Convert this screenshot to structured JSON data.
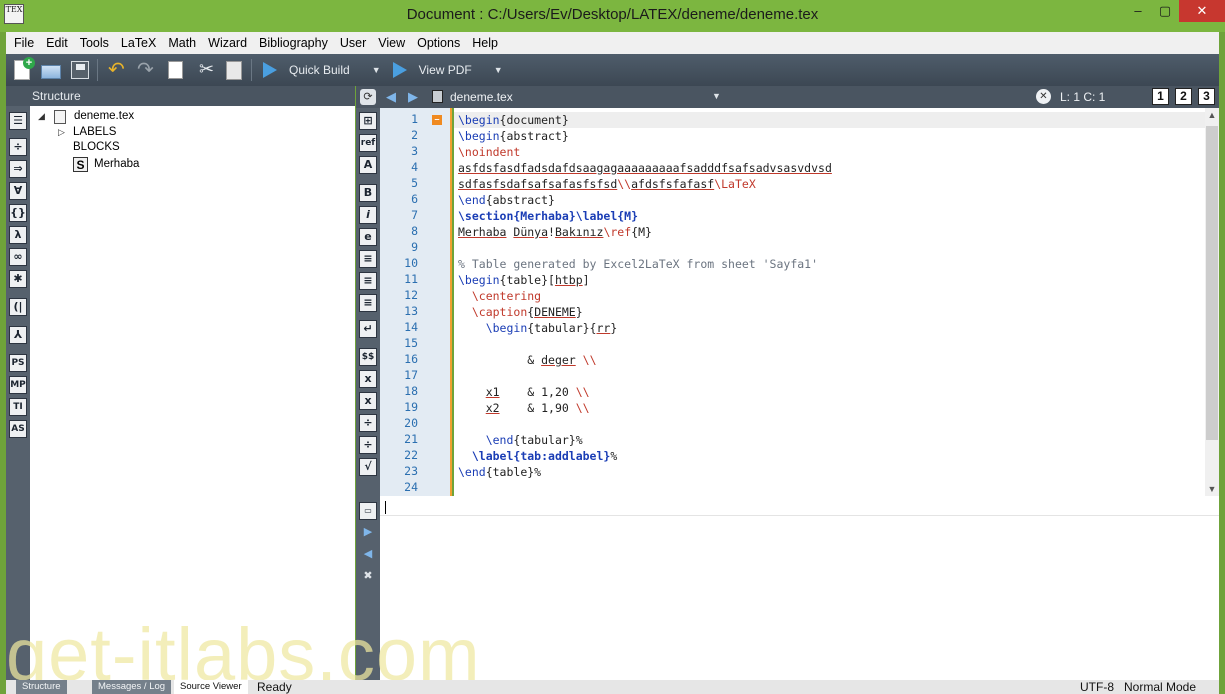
{
  "window": {
    "title": "Document : C:/Users/Ev/Desktop/LATEX/deneme/deneme.tex",
    "app_icon_text": "TEX",
    "close_glyph": "✕",
    "min_glyph": "–",
    "max_glyph": "▢"
  },
  "menu": [
    "File",
    "Edit",
    "Tools",
    "LaTeX",
    "Math",
    "Wizard",
    "Bibliography",
    "User",
    "View",
    "Options",
    "Help"
  ],
  "toolbar": {
    "quick_build_label": "Quick Build",
    "view_pdf_label": "View PDF",
    "icons": [
      "new-file-icon",
      "open-folder-icon",
      "save-icon",
      "undo-icon",
      "redo-icon",
      "copy-icon",
      "cut-icon",
      "paste-icon"
    ]
  },
  "structure": {
    "header": "Structure",
    "file": "deneme.tex",
    "labels": "LABELS",
    "blocks": "BLOCKS",
    "section": "Merhaba",
    "section_icon_letter": "S"
  },
  "left_tools": [
    "☰",
    "÷",
    "⇒",
    "∀",
    "{}",
    "λ",
    "∞",
    "✱",
    "(|",
    "⅄",
    "PS",
    "MP",
    "TI",
    "AS"
  ],
  "editor": {
    "tab_file": "deneme.tex",
    "cursor_pos": "L: 1 C: 1",
    "view_buttons": [
      "1",
      "2",
      "3"
    ],
    "line_numbers": [
      "1",
      "2",
      "3",
      "4",
      "5",
      "6",
      "7",
      "8",
      "9",
      "10",
      "11",
      "12",
      "13",
      "14",
      "15",
      "16",
      "17",
      "18",
      "19",
      "20",
      "21",
      "22",
      "23",
      "24"
    ],
    "tools": [
      "⊞",
      "ref",
      "A",
      "B",
      "i",
      "e",
      "≡",
      "≡",
      "≡",
      "↵",
      "$$",
      "x",
      "x",
      "÷",
      "÷",
      "√"
    ]
  },
  "code": [
    "\\begin{document}",
    "\\begin{abstract}",
    "\\noindent",
    "asfdsfasdfadsdafdsaagagaaaaaaaaafsadddfsafsadvsasvdvsd",
    "sdfasfsdafsafsafasfsfsd\\\\afdsfsfafasf\\LaTeX",
    "\\end{abstract}",
    "\\section{Merhaba}\\label{M}",
    "Merhaba Dünya!Bakınız\\ref{M}",
    "",
    "% Table generated by Excel2LaTeX from sheet 'Sayfa1'",
    "\\begin{table}[htbp]",
    "  \\centering",
    "  \\caption{DENEME}",
    "    \\begin{tabular}{rr}",
    "",
    "          & deger \\\\",
    "",
    "    x1    & 1,20 \\\\",
    "    x2    & 1,90 \\\\",
    "",
    "    \\end{tabular}%",
    "  \\label{tab:addlabel}%",
    "\\end{table}%",
    ""
  ],
  "status": {
    "tab_structure": "Structure",
    "tab_messages": "Messages / Log",
    "tab_source_viewer": "Source Viewer",
    "state": "Ready",
    "encoding": "UTF-8",
    "mode": "Normal Mode"
  },
  "watermark": "get-itlabs.com",
  "colors": {
    "title_bar": "#7cb640",
    "toolbar": "#4f5d6b",
    "accent_orange": "#f0a030",
    "keyword_blue": "#1a3db5",
    "command_red": "#c0392b"
  }
}
